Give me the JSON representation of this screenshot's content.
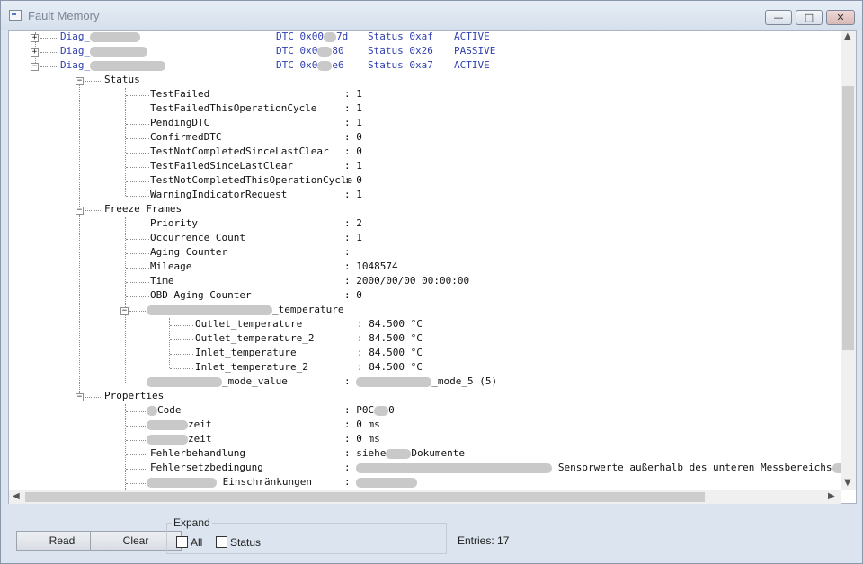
{
  "window": {
    "title": "Fault Memory",
    "minimize": "—",
    "maximize": "□",
    "close": "✕"
  },
  "tree": {
    "diags": [
      {
        "name": "Diag_",
        "dtc": "DTC 0x00",
        "dtc_tail": "7d",
        "status": "Status 0xaf",
        "state": "ACTIVE",
        "expanded": false
      },
      {
        "name": "Diag_",
        "dtc": "DTC 0x0",
        "dtc_tail": "80",
        "status": "Status 0x26",
        "state": "PASSIVE",
        "expanded": false
      },
      {
        "name": "Diag_",
        "dtc": "DTC 0x0",
        "dtc_tail": "e6",
        "status": "Status 0xa7",
        "state": "ACTIVE",
        "expanded": true
      }
    ],
    "status_group": "Status",
    "status_items": [
      {
        "label": "TestFailed",
        "value": ": 1"
      },
      {
        "label": "TestFailedThisOperationCycle",
        "value": ": 1"
      },
      {
        "label": "PendingDTC",
        "value": ": 1"
      },
      {
        "label": "ConfirmedDTC",
        "value": ": 0"
      },
      {
        "label": "TestNotCompletedSinceLastClear",
        "value": ": 0"
      },
      {
        "label": "TestFailedSinceLastClear",
        "value": ": 1"
      },
      {
        "label": "TestNotCompletedThisOperationCycle",
        "value": ": 0"
      },
      {
        "label": "WarningIndicatorRequest",
        "value": ": 1"
      }
    ],
    "freeze_group": "Freeze Frames",
    "freeze_items": [
      {
        "label": "Priority",
        "value": ": 2"
      },
      {
        "label": "Occurrence Count",
        "value": ": 1"
      },
      {
        "label": "Aging Counter",
        "value": ":"
      },
      {
        "label": "Mileage",
        "value": ": 1048574"
      },
      {
        "label": "Time",
        "value": ": 2000/00/00 00:00:00"
      },
      {
        "label": "OBD Aging Counter",
        "value": ": 0"
      }
    ],
    "temp_group_suffix": "_temperature",
    "temp_items": [
      {
        "label": "Outlet_temperature",
        "value": ": 84.500 °C"
      },
      {
        "label": "Outlet_temperature_2",
        "value": ": 84.500 °C"
      },
      {
        "label": "Inlet_temperature",
        "value": ": 84.500 °C"
      },
      {
        "label": "Inlet_temperature_2",
        "value": ": 84.500 °C"
      }
    ],
    "mode_label_suffix": "_mode_value",
    "mode_value_prefix": ":",
    "mode_value_suffix": "_mode_5 (5)",
    "properties_group": "Properties",
    "prop_code_label": "Code",
    "prop_code_value": ": P0C",
    "prop_code_tail": "0",
    "prop_zeit1_label": "zeit",
    "prop_zeit1_value": ": 0 ms",
    "prop_zeit2_label": "zeit",
    "prop_zeit2_value": ": 0 ms",
    "prop_fehler_label": "Fehlerbehandlung",
    "prop_fehler_value": ": siehe",
    "prop_fehler_tail": "Dokumente",
    "prop_ersatz_label": "Fehlersetzbedingung",
    "prop_ersatz_value": ":",
    "prop_ersatz_tail": "Sensorwerte außerhalb des unteren Messbereichs",
    "prop_einschr_label": "Einschränkungen",
    "prop_einschr_value": ":"
  },
  "bottom": {
    "read": "Read",
    "clear": "Clear",
    "expand_group": "Expand",
    "all": "All",
    "status": "Status",
    "entries_label": "Entries:",
    "entries_count": "17"
  }
}
